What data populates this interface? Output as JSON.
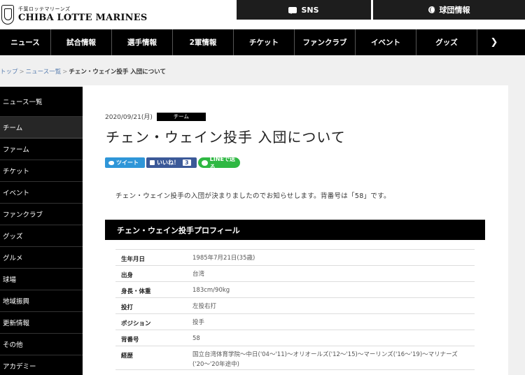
{
  "header": {
    "logo_sub": "千葉ロッテマリーンズ",
    "logo_main": "CHIBA LOTTE MARINES",
    "sns_label": "SNS",
    "stadium_label": "球団情報"
  },
  "nav": [
    {
      "label": "ニュース"
    },
    {
      "label": "試合情報"
    },
    {
      "label": "選手情報"
    },
    {
      "label": "2軍情報"
    },
    {
      "label": "チケット"
    },
    {
      "label": "ファンクラブ"
    },
    {
      "label": "イベント"
    },
    {
      "label": "グッズ"
    },
    {
      "label": "❯"
    }
  ],
  "breadcrumb": {
    "top": "トップ",
    "list": "ニュース一覧",
    "current": "チェン・ウェイン投手 入団について"
  },
  "sidebar": [
    {
      "label": "ニュース一覧"
    },
    {
      "label": "チーム"
    },
    {
      "label": "ファーム"
    },
    {
      "label": "チケット"
    },
    {
      "label": "イベント"
    },
    {
      "label": "ファンクラブ"
    },
    {
      "label": "グッズ"
    },
    {
      "label": "グルメ"
    },
    {
      "label": "球場"
    },
    {
      "label": "地域振興"
    },
    {
      "label": "更新情報"
    },
    {
      "label": "その他"
    },
    {
      "label": "アカデミー"
    }
  ],
  "article": {
    "date": "2020/09/21(月)",
    "category": "チーム",
    "title": "チェン・ウェイン投手 入団について",
    "intro": "チェン・ウェイン投手の入団が決まりましたのでお知らせします。背番号は「58」です。",
    "profile_heading": "チェン・ウェイン投手プロフィール"
  },
  "share": {
    "tweet": "ツイート",
    "like": "いいね！",
    "like_count": "3",
    "line": "LINEで送る"
  },
  "profile": [
    {
      "key": "生年月日",
      "value": "1985年7月21日(35歳)"
    },
    {
      "key": "出身",
      "value": "台湾"
    },
    {
      "key": "身長・体重",
      "value": "183cm/90kg"
    },
    {
      "key": "投打",
      "value": "左投右打"
    },
    {
      "key": "ポジション",
      "value": "投手"
    },
    {
      "key": "背番号",
      "value": "58"
    },
    {
      "key": "経歴",
      "value": "国立台湾体育学院～中日('04～'11)～オリオールズ('12～'15)～マーリンズ('16～'19)～マリナーズ('20～'20年途中)"
    }
  ]
}
